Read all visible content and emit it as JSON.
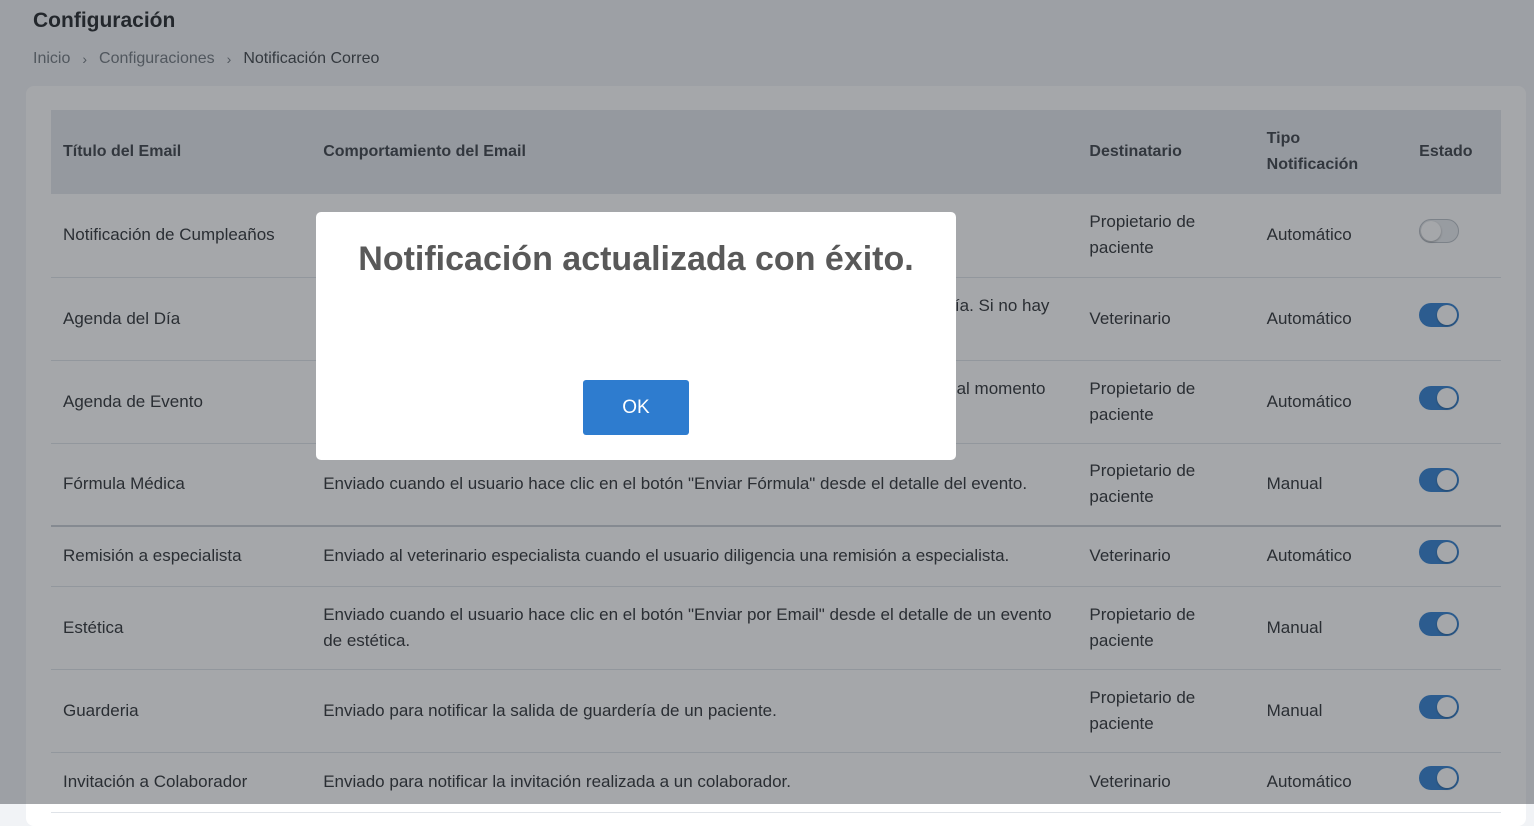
{
  "page": {
    "title": "Configuración",
    "breadcrumb": [
      "Inicio",
      "Configuraciones",
      "Notificación Correo"
    ]
  },
  "table": {
    "headers": {
      "title": "Título del Email",
      "behavior": "Comportamiento del Email",
      "recipient": "Destinatario",
      "type_line1": "Tipo",
      "type_line2": "Notificación",
      "state": "Estado"
    },
    "rows": [
      {
        "title": "Notificación de Cumpleaños",
        "behavior": "",
        "recipient": "Propietario de paciente",
        "type": "Automático",
        "enabled": false
      },
      {
        "title": "Agenda del Día",
        "behavior": "día. Si no hay",
        "recipient": "Veterinario",
        "type": "Automático",
        "enabled": true
      },
      {
        "title": "Agenda de Evento",
        "behavior": "al momento",
        "recipient": "Propietario de paciente",
        "type": "Automático",
        "enabled": true
      },
      {
        "title": "Fórmula Médica",
        "behavior": "Enviado cuando el usuario hace clic en el botón \"Enviar Fórmula\" desde el detalle del evento.",
        "recipient": "Propietario de paciente",
        "type": "Manual",
        "enabled": true
      },
      {
        "title": "Remisión a especialista",
        "behavior": "Enviado al veterinario especialista cuando el usuario diligencia una remisión a especialista.",
        "recipient": "Veterinario",
        "type": "Automático",
        "enabled": true
      },
      {
        "title": "Estética",
        "behavior": "Enviado cuando el usuario hace clic en el botón \"Enviar por Email\" desde el detalle de un evento de estética.",
        "recipient": "Propietario de paciente",
        "type": "Manual",
        "enabled": true
      },
      {
        "title": "Guarderia",
        "behavior": "Enviado para notificar la salida de guardería de un paciente.",
        "recipient": "Propietario de paciente",
        "type": "Manual",
        "enabled": true
      },
      {
        "title": "Invitación a Colaborador",
        "behavior": "Enviado para notificar la invitación realizada a un colaborador.",
        "recipient": "Veterinario",
        "type": "Automático",
        "enabled": true
      }
    ]
  },
  "modal": {
    "message": "Notificación actualizada con éxito.",
    "ok_label": "OK"
  },
  "colors": {
    "accent": "#2e7ccf",
    "overlay": "#282d34"
  }
}
